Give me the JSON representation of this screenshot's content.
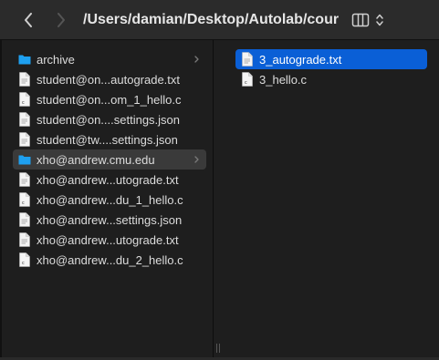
{
  "toolbar": {
    "path": "/Users/damian/Desktop/Autolab/cour..."
  },
  "left_column": {
    "items": [
      {
        "label": "archive",
        "type": "folder"
      },
      {
        "label": "student@on...autograde.txt",
        "type": "text-file"
      },
      {
        "label": "student@on...om_1_hello.c",
        "type": "c-file"
      },
      {
        "label": "student@on....settings.json",
        "type": "text-file"
      },
      {
        "label": "student@tw....settings.json",
        "type": "text-file"
      },
      {
        "label": "xho@andrew.cmu.edu",
        "type": "folder"
      },
      {
        "label": "xho@andrew...utograde.txt",
        "type": "text-file"
      },
      {
        "label": "xho@andrew...du_1_hello.c",
        "type": "c-file"
      },
      {
        "label": "xho@andrew...settings.json",
        "type": "text-file"
      },
      {
        "label": "xho@andrew...utograde.txt",
        "type": "text-file"
      },
      {
        "label": "xho@andrew...du_2_hello.c",
        "type": "c-file"
      }
    ]
  },
  "right_column": {
    "items": [
      {
        "label": "3_autograde.txt",
        "type": "text-file"
      },
      {
        "label": "3_hello.c",
        "type": "c-file"
      }
    ]
  },
  "colors": {
    "selection": "#0a5fd6",
    "folder": "#1ea0f0",
    "background": "#1e1e1e"
  }
}
